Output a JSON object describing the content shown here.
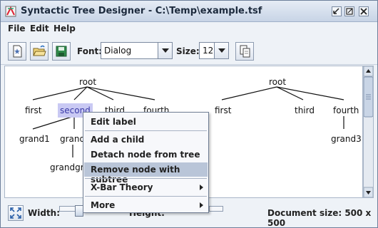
{
  "window": {
    "title": "Syntactic Tree Designer - C:\\Temp\\example.tsf"
  },
  "menubar": {
    "items": [
      "File",
      "Edit",
      "Help"
    ]
  },
  "toolbar": {
    "font_label": "Font:",
    "font_value": "Dialog",
    "size_label": "Size:",
    "size_value": "12"
  },
  "tree_left": {
    "root": "root",
    "children": [
      "first",
      "second",
      "third",
      "fourth"
    ],
    "grandchildren": [
      "grand1",
      "grand"
    ],
    "great_grandchild": "grandgra"
  },
  "tree_right": {
    "root": "root",
    "children": [
      "first",
      "third",
      "fourth"
    ],
    "grandchild": "grand3"
  },
  "context_menu": {
    "items": [
      {
        "label": "Edit label"
      },
      {
        "label": "Add a child"
      },
      {
        "label": "Detach node from tree"
      },
      {
        "label": "Remove node with subtree",
        "highlighted": true
      },
      {
        "label": "X-Bar Theory",
        "submenu": true
      },
      {
        "label": "More",
        "submenu": true
      }
    ]
  },
  "statusbar": {
    "width_label": "Width:",
    "height_label": "Height:",
    "document_size": "Document size: 500 x 500",
    "width_slider_fraction": 0.05
  },
  "colors": {
    "selected_bg": "#c9c9f3",
    "selected_text": "#3a3aa8",
    "menu_highlight": "#b9c5d8"
  }
}
